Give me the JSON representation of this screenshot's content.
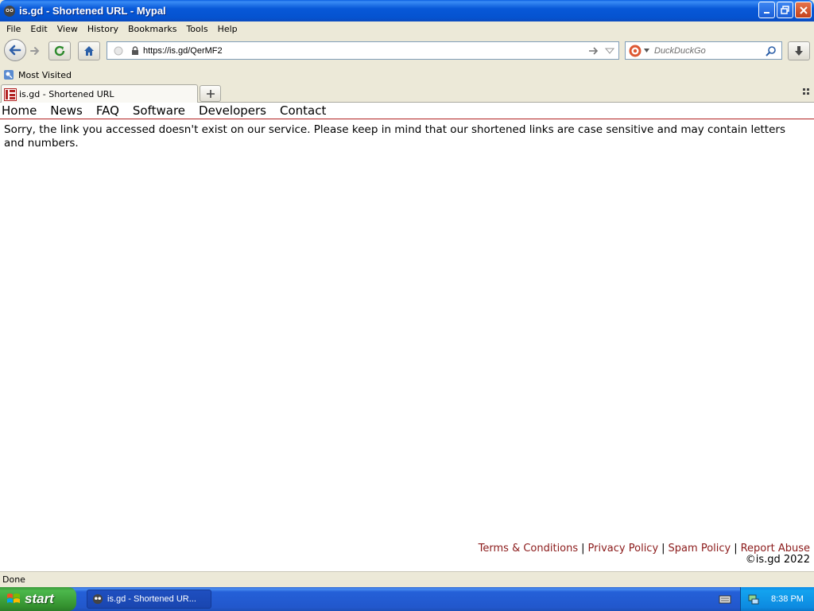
{
  "window": {
    "title": "is.gd - Shortened URL - Mypal"
  },
  "menu": [
    "File",
    "Edit",
    "View",
    "History",
    "Bookmarks",
    "Tools",
    "Help"
  ],
  "navbar": {
    "url": "https://is.gd/QerMF2",
    "search_placeholder": "DuckDuckGo"
  },
  "bookmarks": {
    "most_visited": "Most Visited"
  },
  "tabs": [
    {
      "label": "is.gd - Shortened URL"
    }
  ],
  "page": {
    "nav": [
      "Home",
      "News",
      "FAQ",
      "Software",
      "Developers",
      "Contact"
    ],
    "message": "Sorry, the link you accessed doesn't exist on our service. Please keep in mind that our shortened links are case sensitive and may contain letters and numbers.",
    "footer": {
      "links": [
        "Terms & Conditions",
        "Privacy Policy",
        "Spam Policy",
        "Report Abuse"
      ],
      "copyright": "©is.gd 2022"
    }
  },
  "status": "Done",
  "taskbar": {
    "start_label": "start",
    "task_label": "is.gd - Shortened UR...",
    "clock": "8:38 PM"
  },
  "colors": {
    "link": "#8b1a1a",
    "nav_rule": "#b22222",
    "titlebar": "#0858d8"
  }
}
